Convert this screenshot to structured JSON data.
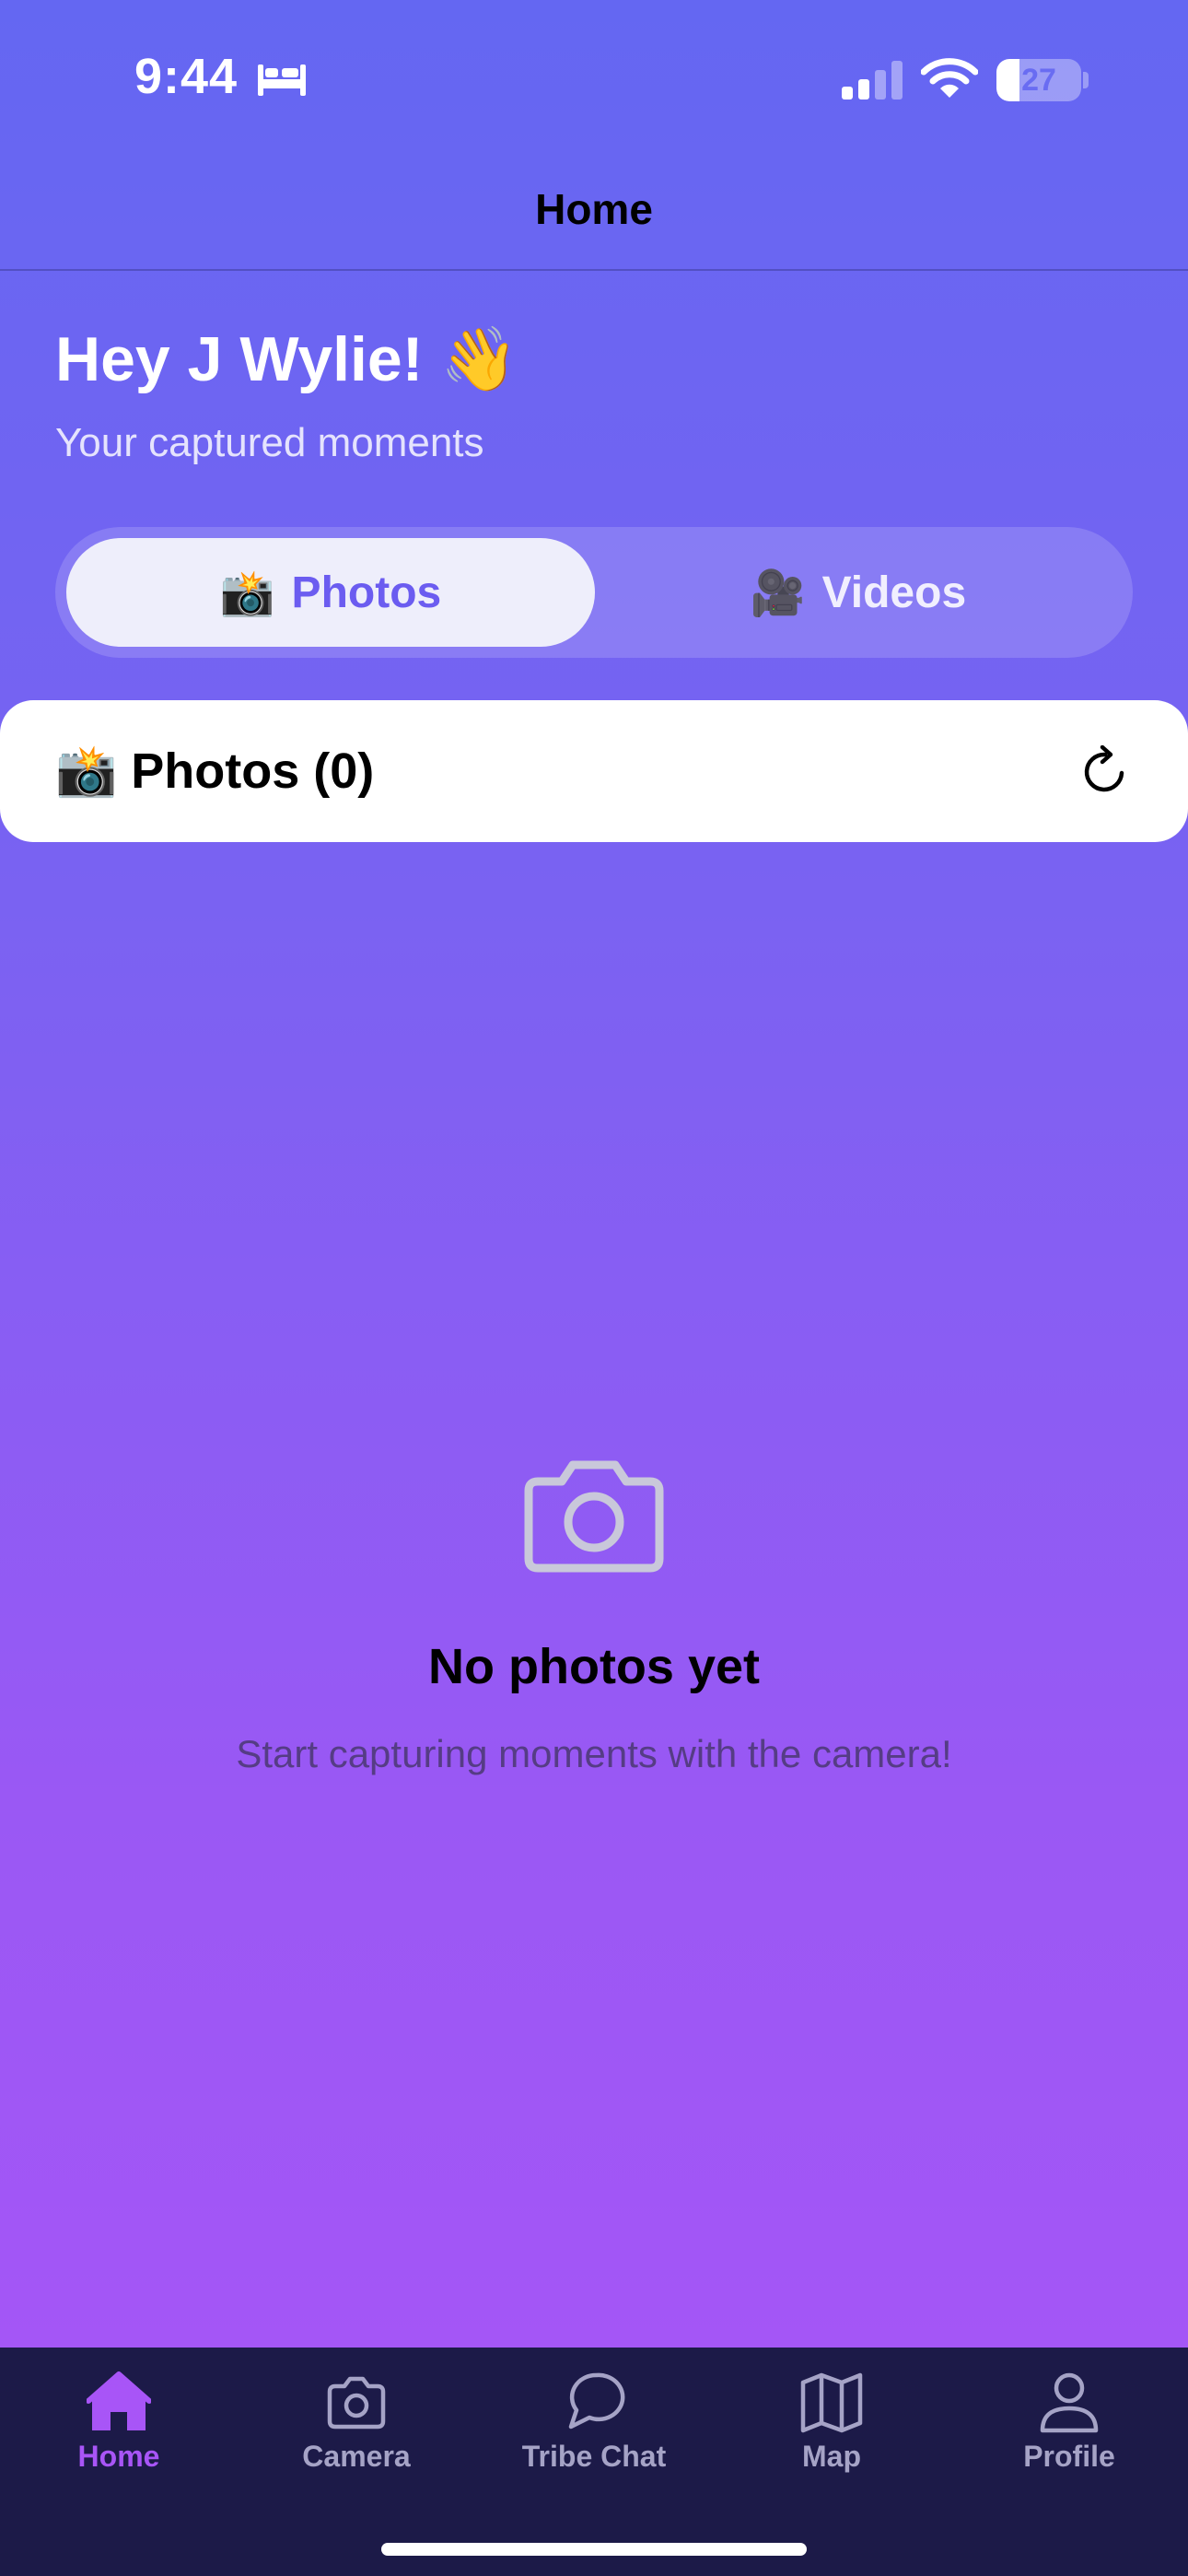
{
  "status_bar": {
    "time": "9:44",
    "battery": "27",
    "battery_level": 0.27,
    "icons": [
      "bed-icon",
      "signal-icon",
      "wifi-icon",
      "battery-icon"
    ]
  },
  "nav": {
    "title": "Home"
  },
  "greeting": {
    "title": "Hey J Wylie! 👋",
    "subtitle": "Your captured moments"
  },
  "segmented": {
    "photos": {
      "emoji": "📸",
      "label": "Photos",
      "selected": true
    },
    "videos": {
      "emoji": "🎥",
      "label": "Videos",
      "selected": false
    }
  },
  "photos_section": {
    "title": "📸 Photos (0)",
    "icon": "refresh-icon"
  },
  "empty_state": {
    "icon": "camera-icon",
    "title": "No photos yet",
    "subtitle": "Start capturing moments with the camera!"
  },
  "tab_bar": {
    "items": [
      {
        "label": "Home",
        "icon": "home-icon",
        "active": true
      },
      {
        "label": "Camera",
        "icon": "camera-icon",
        "active": false
      },
      {
        "label": "Tribe Chat",
        "icon": "chat-bubble-icon",
        "active": false
      },
      {
        "label": "Map",
        "icon": "map-icon",
        "active": false
      },
      {
        "label": "Profile",
        "icon": "person-icon",
        "active": false
      }
    ]
  },
  "colors": {
    "gradient_top": "#6467f2",
    "gradient_bottom": "#a855f7",
    "tab_bar_bg": "#1c1a48",
    "active_tab": "#a855f7",
    "segment_active_text": "#6b5cf0"
  }
}
